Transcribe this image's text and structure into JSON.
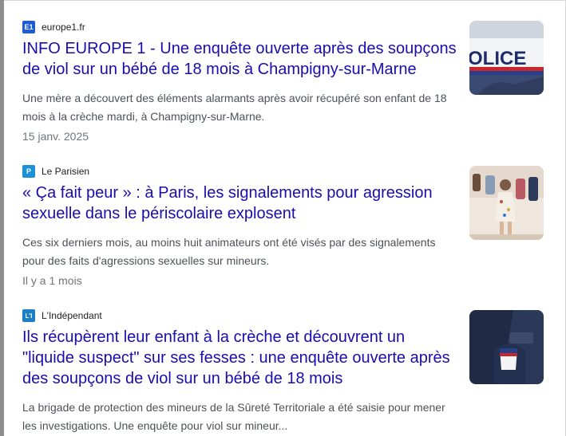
{
  "articles": [
    {
      "source": "europe1.fr",
      "logo_text": "E1",
      "logo_color": "#1f5bd1",
      "title": "INFO EUROPE 1 - Une enquête ouverte après des soupçons de viol sur un bébé de 18 mois à Champigny-sur-Marne",
      "snippet": "Une mère a découvert des éléments alarmants après avoir récupéré son enfant de 18 mois à la crèche mardi, à Champigny-sur-Marne.",
      "date": "15 janv. 2025",
      "thumb_text": "OLICE"
    },
    {
      "source": "Le Parisien",
      "logo_text": "P",
      "logo_color": "#1b8fd8",
      "title": "« Ça fait peur » : à Paris, les signalements pour agression sexuelle dans le périscolaire explosent",
      "snippet": "Ces six derniers mois, au moins huit animateurs ont été visés par des signalements pour des faits d'agressions sexuelles sur mineurs.",
      "date": "Il y a 1 mois"
    },
    {
      "source": "L'Indépendant",
      "logo_text": "L'I",
      "logo_color": "#1e7fc9",
      "title": "Ils récupèrent leur enfant à la crèche et découvrent un \"liquide suspect\" sur ses fesses : une enquête ouverte après des soupçons de viol sur un bébé de 18 mois",
      "snippet": "La brigade de protection des mineurs de la Sûreté Territoriale a été saisie pour mener les investigations. Une enquête pour viol sur mineur..."
    }
  ]
}
